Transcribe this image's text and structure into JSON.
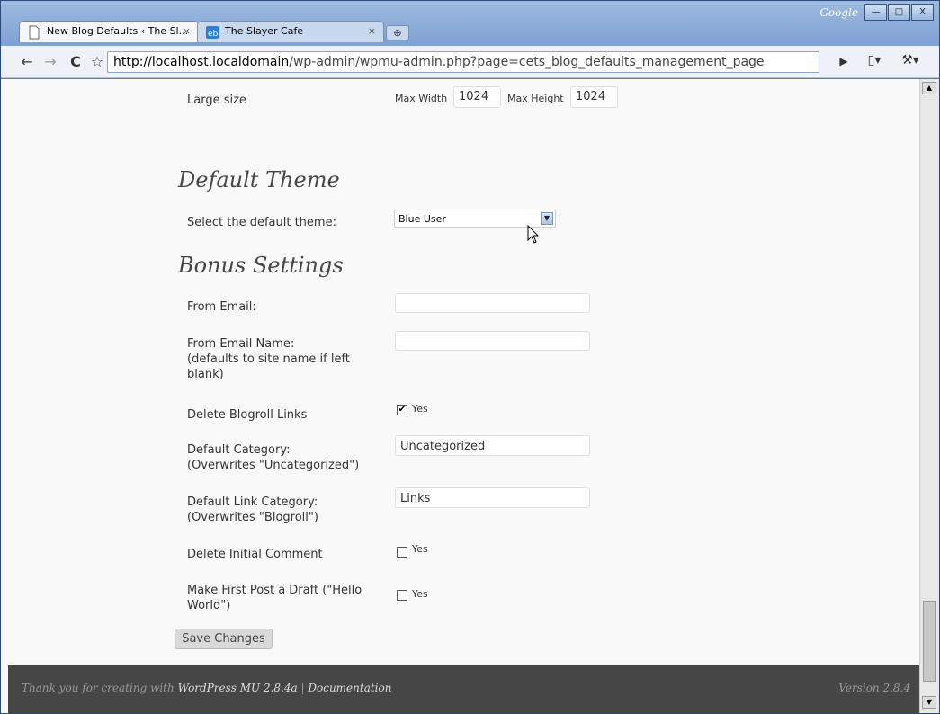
{
  "browser": {
    "tabs": [
      {
        "label": "New Blog Defaults ‹ The Sl...",
        "close": "×"
      },
      {
        "label": "The Slayer Cafe",
        "close": "×"
      }
    ],
    "new_tab": "⊕",
    "brand": "Google",
    "window_controls": {
      "minimize": "—",
      "maximize": "□",
      "close": "X"
    },
    "url_host": "http://localhost.localdomain",
    "url_path": "/wp-admin/wpmu-admin.php?page=cets_blog_defaults_management_page"
  },
  "media": {
    "large_size_label": "Large size",
    "max_width_label": "Max Width",
    "max_width_value": "1024",
    "max_height_label": "Max Height",
    "max_height_value": "1024"
  },
  "default_theme": {
    "heading": "Default Theme",
    "select_label": "Select the default theme:",
    "selected": "Blue User"
  },
  "bonus": {
    "heading": "Bonus Settings",
    "from_email_label": "From Email:",
    "from_email_value": "",
    "from_email_name_label": "From Email Name:\n(defaults to site name if left blank)",
    "from_email_name_value": "",
    "delete_blogroll_label": "Delete Blogroll Links",
    "delete_blogroll_checked": true,
    "default_category_label": "Default Category:\n(Overwrites \"Uncategorized\")",
    "default_category_value": "Uncategorized",
    "default_link_category_label": "Default Link Category:\n(Overwrites \"Blogroll\")",
    "default_link_category_value": "Links",
    "delete_initial_comment_label": "Delete Initial Comment",
    "delete_initial_comment_checked": false,
    "first_post_draft_label": "Make First Post a Draft (\"Hello World\")",
    "first_post_draft_checked": false,
    "yes": "Yes"
  },
  "save_button": "Save Changes",
  "footer": {
    "thanks": "Thank you for creating with",
    "product": "WordPress MU 2.8.4a",
    "separator": "|",
    "docs": "Documentation",
    "version": "Version 2.8.4"
  }
}
